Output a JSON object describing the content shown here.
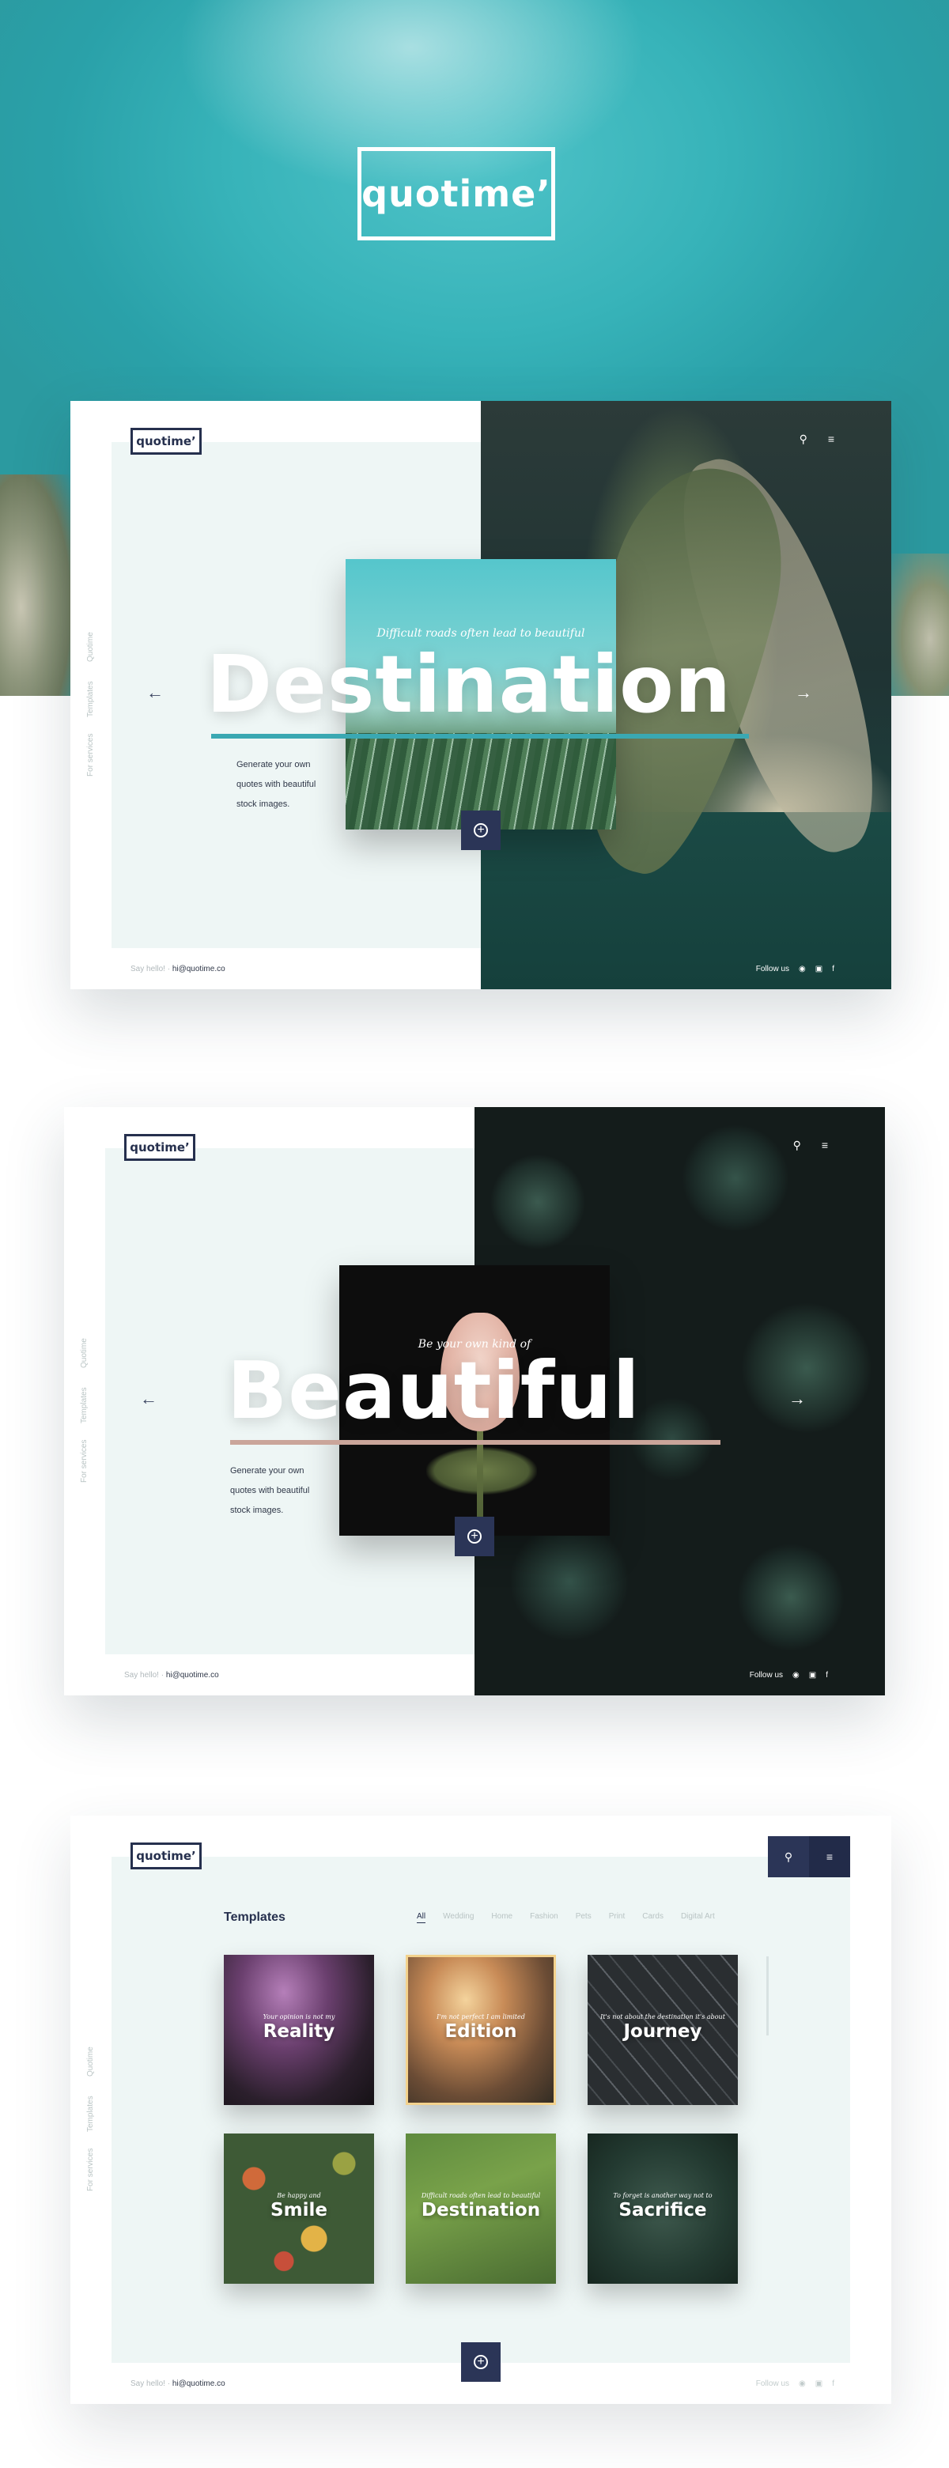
{
  "hero": {
    "logo": "quotime’"
  },
  "slides": [
    {
      "logo": "quotime’",
      "nav_vertical": [
        "Quotime",
        "Templates",
        "For services"
      ],
      "quote": "Difficult roads often lead to beautiful",
      "word": "Destination",
      "underline_color": "#3aa8b2",
      "tagline": [
        "Generate your own",
        "quotes with beautiful",
        "stock images."
      ],
      "footer": {
        "say_hello": "Say hello! ·",
        "email": "hi@quotime.co",
        "follow": "Follow us"
      }
    },
    {
      "logo": "quotime’",
      "nav_vertical": [
        "Quotime",
        "Templates",
        "For services"
      ],
      "quote": "Be your own kind of",
      "word": "Beautiful",
      "underline_color": "#caa59a",
      "tagline": [
        "Generate your own",
        "quotes with beautiful",
        "stock images."
      ],
      "footer": {
        "say_hello": "Say hello! ·",
        "email": "hi@quotime.co",
        "follow": "Follow us"
      }
    }
  ],
  "templates": {
    "logo": "quotime’",
    "title": "Templates",
    "nav_vertical": [
      "Quotime",
      "Templates",
      "For services"
    ],
    "filters": [
      "All",
      "Wedding",
      "Home",
      "Fashion",
      "Pets",
      "Print",
      "Cards",
      "Digital Art"
    ],
    "active_filter": "All",
    "tiles": [
      {
        "quote": "Your opinion is not my",
        "word": "Reality",
        "bg": "storm"
      },
      {
        "quote": "I'm not perfect I am limited",
        "word": "Edition",
        "bg": "sunset",
        "selected": true
      },
      {
        "quote": "It's not about the destination it's about",
        "word": "Journey",
        "bg": "road"
      },
      {
        "quote": "Be happy and",
        "word": "Smile",
        "bg": "autumn"
      },
      {
        "quote": "Difficult roads often lead to beautiful",
        "word": "Destination",
        "bg": "field"
      },
      {
        "quote": "To forget is another way not to",
        "word": "Sacrifice",
        "bg": "forest"
      }
    ],
    "footer": {
      "say_hello": "Say hello! ·",
      "email": "hi@quotime.co",
      "follow": "Follow us"
    }
  },
  "icons": [
    "search-icon",
    "menu-icon",
    "arrow-left-icon",
    "arrow-right-icon",
    "plus-icon",
    "pinterest-icon",
    "instagram-icon",
    "facebook-icon"
  ]
}
